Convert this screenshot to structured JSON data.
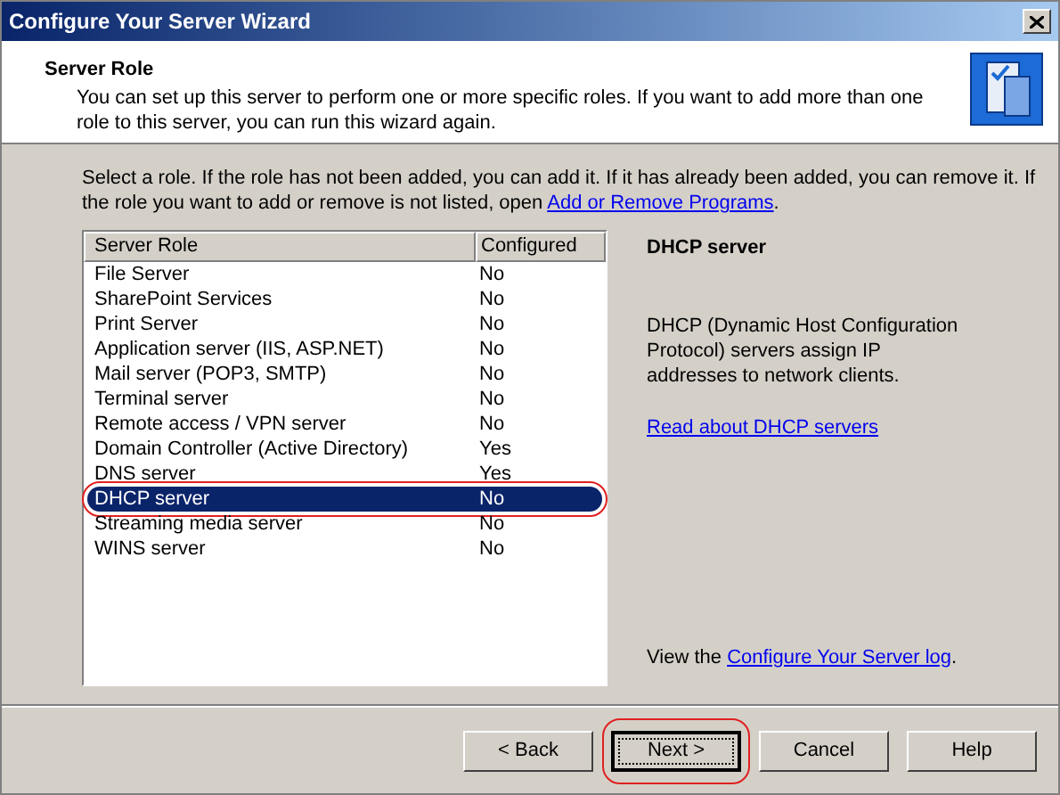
{
  "window": {
    "title": "Configure Your Server Wizard"
  },
  "header": {
    "title": "Server Role",
    "description": "You can set up this server to perform one or more specific roles. If you want to add more than one role to this server, you can run this wizard again."
  },
  "instructions": {
    "text_before": "Select a role. If the role has not been added, you can add it. If it has already been added, you can remove it. If the role you want to add or remove is not listed, open",
    "link": "Add or Remove Programs",
    "text_after": "."
  },
  "roles": {
    "columns": [
      "Server Role",
      "Configured"
    ],
    "rows": [
      {
        "role": "File Server",
        "configured": "No",
        "selected": false,
        "highlighted": false
      },
      {
        "role": "SharePoint Services",
        "configured": "No",
        "selected": false,
        "highlighted": false
      },
      {
        "role": "Print Server",
        "configured": "No",
        "selected": false,
        "highlighted": false
      },
      {
        "role": "Application server (IIS, ASP.NET)",
        "configured": "No",
        "selected": false,
        "highlighted": false
      },
      {
        "role": "Mail server (POP3, SMTP)",
        "configured": "No",
        "selected": false,
        "highlighted": false
      },
      {
        "role": "Terminal server",
        "configured": "No",
        "selected": false,
        "highlighted": false
      },
      {
        "role": "Remote access / VPN server",
        "configured": "No",
        "selected": false,
        "highlighted": false
      },
      {
        "role": "Domain Controller (Active Directory)",
        "configured": "Yes",
        "selected": false,
        "highlighted": false
      },
      {
        "role": "DNS server",
        "configured": "Yes",
        "selected": false,
        "highlighted": false
      },
      {
        "role": "DHCP server",
        "configured": "No",
        "selected": true,
        "highlighted": true
      },
      {
        "role": "Streaming media server",
        "configured": "No",
        "selected": false,
        "highlighted": false
      },
      {
        "role": "WINS server",
        "configured": "No",
        "selected": false,
        "highlighted": false
      }
    ]
  },
  "details": {
    "title": "DHCP server",
    "description": "DHCP (Dynamic Host Configuration Protocol) servers assign IP addresses to network clients.",
    "link": "Read about DHCP servers",
    "log_before": "View the",
    "log_link": "Configure Your Server log",
    "log_after": "."
  },
  "buttons": [
    {
      "label": "< Back",
      "default": false,
      "highlighted": false
    },
    {
      "label": "Next >",
      "default": true,
      "highlighted": true
    },
    {
      "label": "Cancel",
      "default": false,
      "highlighted": false
    },
    {
      "label": "Help",
      "default": false,
      "highlighted": false
    }
  ]
}
